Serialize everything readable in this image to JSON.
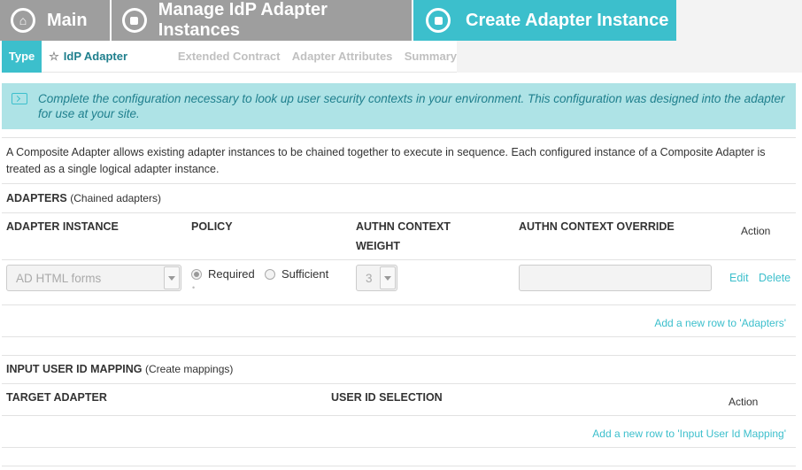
{
  "breadcrumbs": {
    "main": "Main",
    "manage": "Manage IdP Adapter Instances",
    "create": "Create Adapter Instance"
  },
  "steps": {
    "type": "Type",
    "idp_adapter": "IdP Adapter",
    "extended_contract": "Extended Contract",
    "adapter_attributes": "Adapter Attributes",
    "summary": "Summary"
  },
  "banner": {
    "text": "Complete the configuration necessary to look up user security contexts in your environment. This configuration was designed into the adapter for use at your site."
  },
  "description": "A Composite Adapter allows existing adapter instances to be chained together to execute in sequence. Each configured instance of a Composite Adapter is treated as a single logical adapter instance.",
  "adapters": {
    "title": "ADAPTERS",
    "subtitle": "(Chained adapters)",
    "columns": {
      "instance": "ADAPTER INSTANCE",
      "policy": "POLICY",
      "weight_line1": "AUTHN CONTEXT",
      "weight_line2": "WEIGHT",
      "override": "AUTHN CONTEXT OVERRIDE",
      "action": "Action"
    },
    "row": {
      "instance": "AD HTML forms",
      "policy_required": "Required",
      "policy_sufficient": "Sufficient",
      "weight": "3",
      "override": "",
      "edit": "Edit",
      "delete": "Delete"
    },
    "add_row": "Add a new row to 'Adapters'"
  },
  "mapping": {
    "title": "INPUT USER ID MAPPING",
    "subtitle": "(Create mappings)",
    "columns": {
      "target": "TARGET ADAPTER",
      "selection": "USER ID SELECTION",
      "action": "Action"
    },
    "add_row": "Add a new row to 'Input User Id Mapping'"
  },
  "colors": {
    "accent": "#3cbfcc",
    "crumb_inactive": "#9e9e9e",
    "banner_bg": "#aee3e6",
    "banner_text": "#1f7f8d"
  },
  "icons": {
    "main": "home-icon",
    "manage": "stop-circle-icon",
    "create": "stop-circle-icon",
    "banner": "info-panel-icon",
    "idp_step": "star-icon"
  }
}
